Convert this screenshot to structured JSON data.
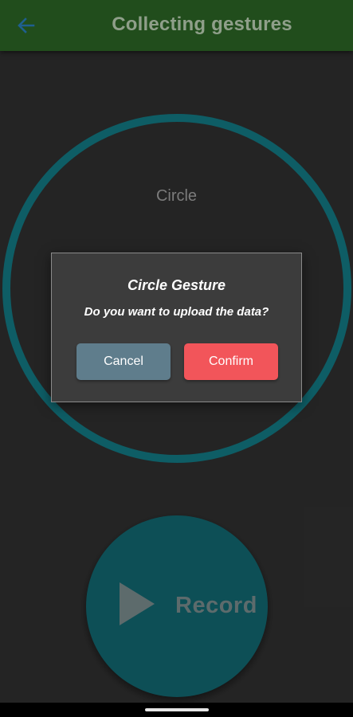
{
  "app_bar": {
    "title": "Collecting gestures",
    "back_icon": "arrow-left-icon",
    "background": "#214d1c"
  },
  "gesture": {
    "label": "Circle",
    "ring_color": "#116a74"
  },
  "record_button": {
    "label": "Record",
    "icon": "play-icon",
    "color": "#0f5a62"
  },
  "dialog": {
    "title": "Circle Gesture",
    "message": "Do you want to upload the data?",
    "cancel_label": "Cancel",
    "confirm_label": "Confirm",
    "cancel_color": "#5f7d8c",
    "confirm_color": "#f2555a"
  },
  "system_nav": {
    "home_indicator": "home-pill"
  }
}
